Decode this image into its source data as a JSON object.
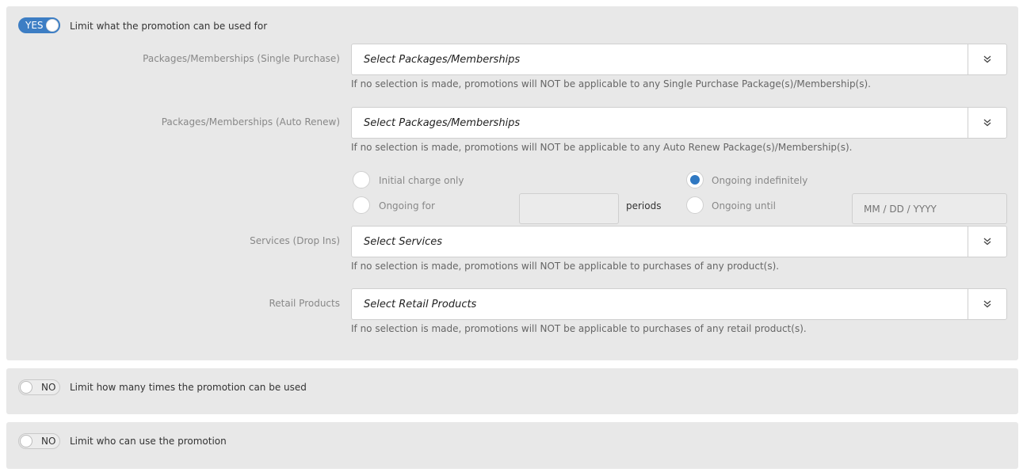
{
  "limit_usage": {
    "toggle": "YES",
    "title": "Limit what the promotion can be used for",
    "single_purchase": {
      "label": "Packages/Memberships (Single Purchase)",
      "select_text": "Select Packages/Memberships",
      "help": "If no selection is made, promotions will NOT be applicable to any Single Purchase Package(s)/Membership(s)."
    },
    "auto_renew": {
      "label": "Packages/Memberships (Auto Renew)",
      "select_text": "Select Packages/Memberships",
      "help": "If no selection is made, promotions will NOT be applicable to any Auto Renew Package(s)/Membership(s).",
      "options": {
        "initial_charge": "Initial charge only",
        "ongoing_for": "Ongoing for",
        "periods": "periods",
        "ongoing_indefinitely": "Ongoing indefinitely",
        "ongoing_until": "Ongoing until",
        "date_placeholder": "MM / DD / YYYY",
        "selected": "ongoing_indefinitely"
      }
    },
    "services": {
      "label": "Services (Drop Ins)",
      "select_text": "Select Services",
      "help": "If no selection is made, promotions will NOT be applicable to purchases of any product(s)."
    },
    "retail": {
      "label": "Retail Products",
      "select_text": "Select Retail Products",
      "help": "If no selection is made, promotions will NOT be applicable to purchases of any retail product(s)."
    }
  },
  "limit_times": {
    "toggle": "NO",
    "title": "Limit how many times the promotion can be used"
  },
  "limit_who": {
    "toggle": "NO",
    "title": "Limit who can use the promotion"
  },
  "icons": {
    "dropdown": "double-chevron-down-icon"
  },
  "colors": {
    "accent": "#3d7ec4",
    "panel_bg": "#e8e8e8"
  }
}
